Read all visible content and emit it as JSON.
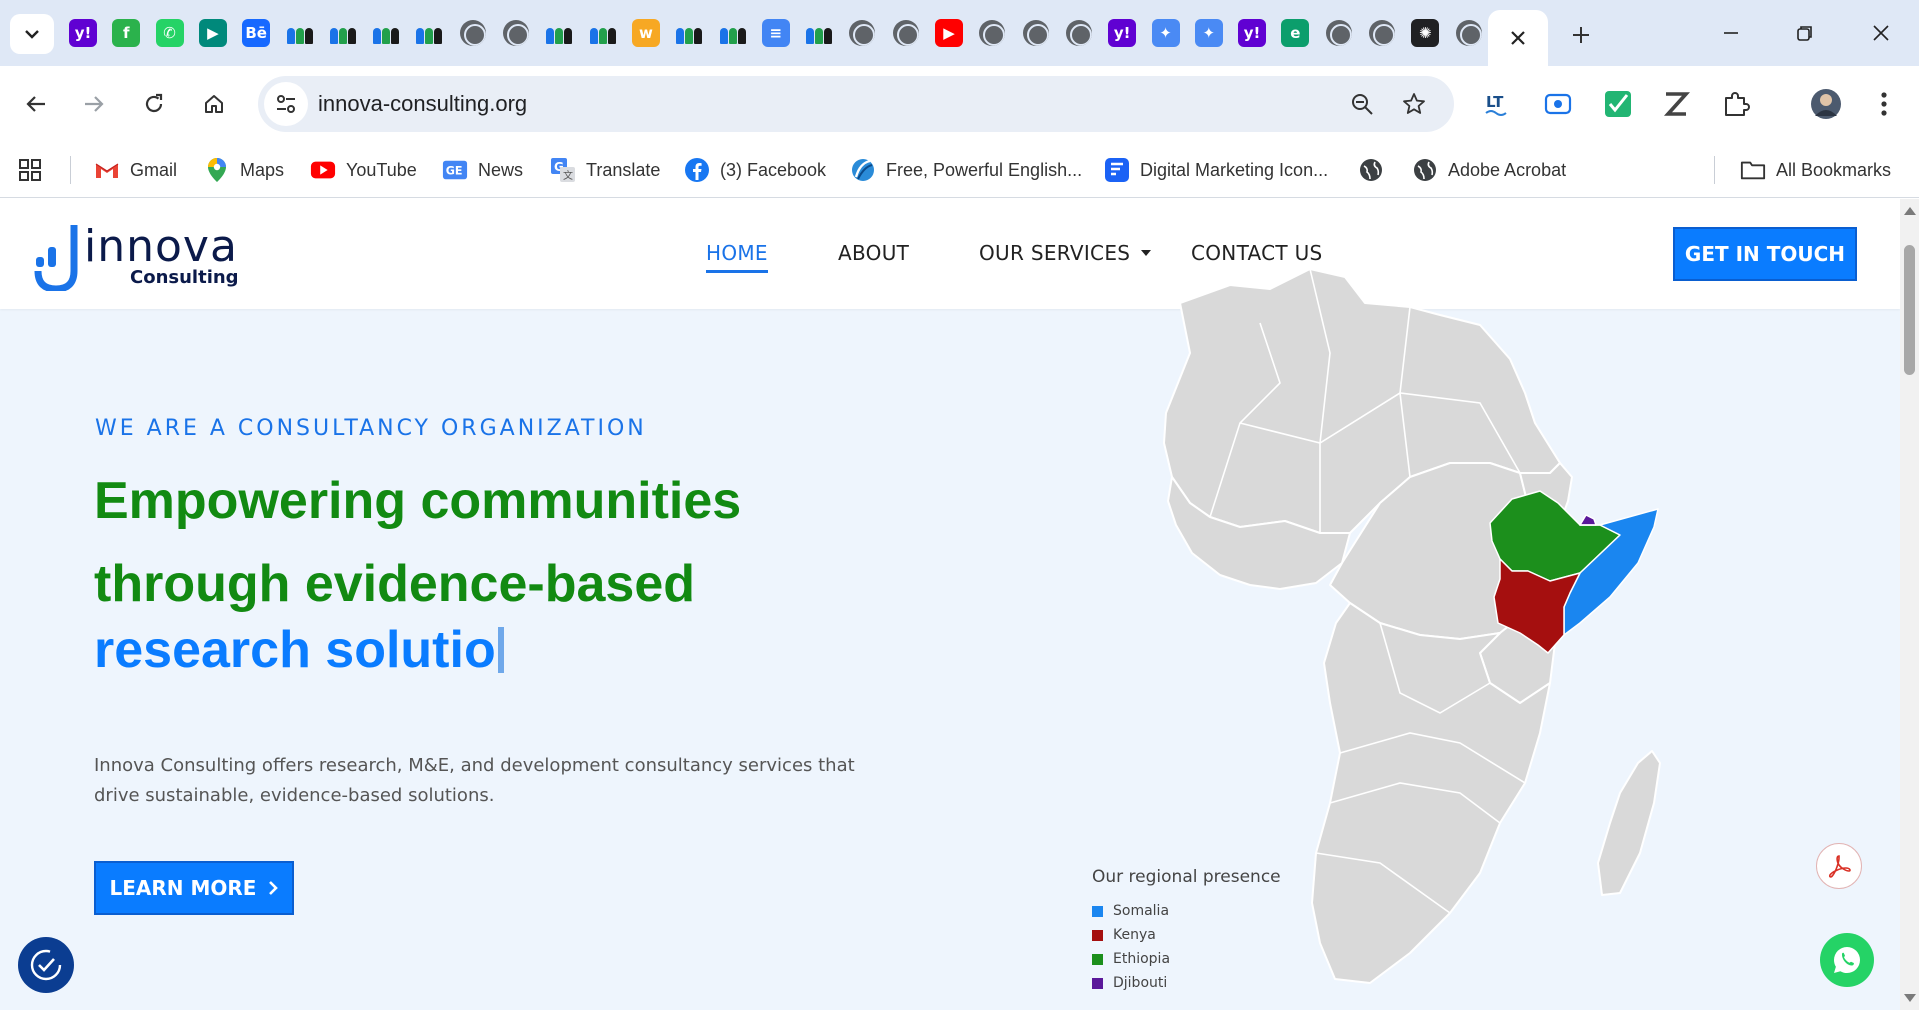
{
  "browser": {
    "url": "innova-consulting.org",
    "tab_favicons": [
      "yahoo-icon",
      "feedly-icon",
      "whatsapp-icon",
      "meet-icon",
      "behance-icon",
      "people-icon",
      "people-icon",
      "people-icon",
      "people-icon",
      "globe-icon",
      "globe-icon",
      "people-icon",
      "people-icon",
      "workday-icon",
      "people-icon",
      "people-icon",
      "doc-icon",
      "people-icon",
      "globe-icon",
      "globe-icon",
      "youtube-icon",
      "globe-icon",
      "globe-icon",
      "globe-icon",
      "yahoo-icon",
      "gemini-icon",
      "gemini-icon",
      "yahoo-icon",
      "edge-icon",
      "globe-icon",
      "globe-icon",
      "openai-icon",
      "globe-icon"
    ],
    "bookmarks": [
      {
        "label": "Gmail",
        "icon": "gmail-icon"
      },
      {
        "label": "Maps",
        "icon": "maps-icon"
      },
      {
        "label": "YouTube",
        "icon": "youtube-icon"
      },
      {
        "label": "News",
        "icon": "news-icon"
      },
      {
        "label": "Translate",
        "icon": "translate-icon"
      },
      {
        "label": "(3) Facebook",
        "icon": "facebook-icon"
      },
      {
        "label": "Free, Powerful English...",
        "icon": "language-icon"
      },
      {
        "label": "Digital Marketing Icon...",
        "icon": "flaticon-icon"
      },
      {
        "label": "",
        "icon": "globe-icon"
      },
      {
        "label": "Adobe Acrobat",
        "icon": "globe-icon"
      }
    ],
    "all_bookmarks": "All Bookmarks"
  },
  "site": {
    "logo_word": "innova",
    "logo_sub": "Consulting",
    "nav": [
      "HOME",
      "ABOUT",
      "OUR SERVICES",
      "CONTACT US"
    ],
    "cta": "GET IN TOUCH"
  },
  "hero": {
    "kicker": "WE ARE A CONSULTANCY ORGANIZATION",
    "line1": "Empowering communities",
    "line2": "through evidence-based",
    "line3": "research solutio",
    "intro": "Innova Consulting offers  research, M&E, and development consultancy services that drive sustainable, evidence-based solutions.",
    "button": "LEARN MORE"
  },
  "map": {
    "legend_title": "Our regional presence",
    "countries": [
      {
        "name": "Somalia",
        "color": "#1a86f0"
      },
      {
        "name": "Kenya",
        "color": "#a50f0f"
      },
      {
        "name": "Ethiopia",
        "color": "#1c8f1c"
      },
      {
        "name": "Djibouti",
        "color": "#5a189a"
      }
    ],
    "base_color": "#d9d9d9"
  },
  "colors": {
    "accent": "#0a7cff",
    "green": "#128a12"
  }
}
